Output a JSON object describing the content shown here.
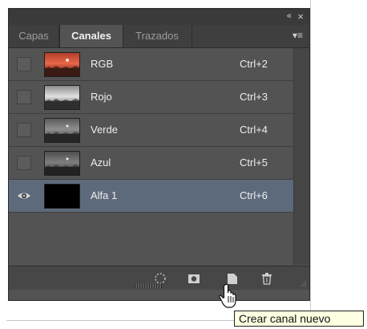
{
  "panel": {
    "collapse_glyph": "«",
    "close_glyph": "×",
    "tabs": [
      {
        "label": "Capas",
        "active": false
      },
      {
        "label": "Canales",
        "active": true
      },
      {
        "label": "Trazados",
        "active": false
      }
    ],
    "menu_glyph": "▾≡"
  },
  "channels": [
    {
      "name": "RGB",
      "shortcut": "Ctrl+2",
      "visible": false,
      "selected": false,
      "thumb": "rgb"
    },
    {
      "name": "Rojo",
      "shortcut": "Ctrl+3",
      "visible": false,
      "selected": false,
      "thumb": "gray"
    },
    {
      "name": "Verde",
      "shortcut": "Ctrl+4",
      "visible": false,
      "selected": false,
      "thumb": "gray"
    },
    {
      "name": "Azul",
      "shortcut": "Ctrl+5",
      "visible": false,
      "selected": false,
      "thumb": "gray"
    },
    {
      "name": "Alfa 1",
      "shortcut": "Ctrl+6",
      "visible": true,
      "selected": true,
      "thumb": "black"
    }
  ],
  "footer_buttons": [
    {
      "name": "load-channel-as-selection-icon"
    },
    {
      "name": "save-selection-as-channel-icon"
    },
    {
      "name": "create-new-channel-icon"
    },
    {
      "name": "delete-channel-icon"
    }
  ],
  "tooltip": {
    "text": "Crear canal nuevo"
  },
  "colors": {
    "panel_bg": "#535353",
    "selected_row": "#5d6a7b",
    "tooltip_bg": "#ffffe1"
  }
}
